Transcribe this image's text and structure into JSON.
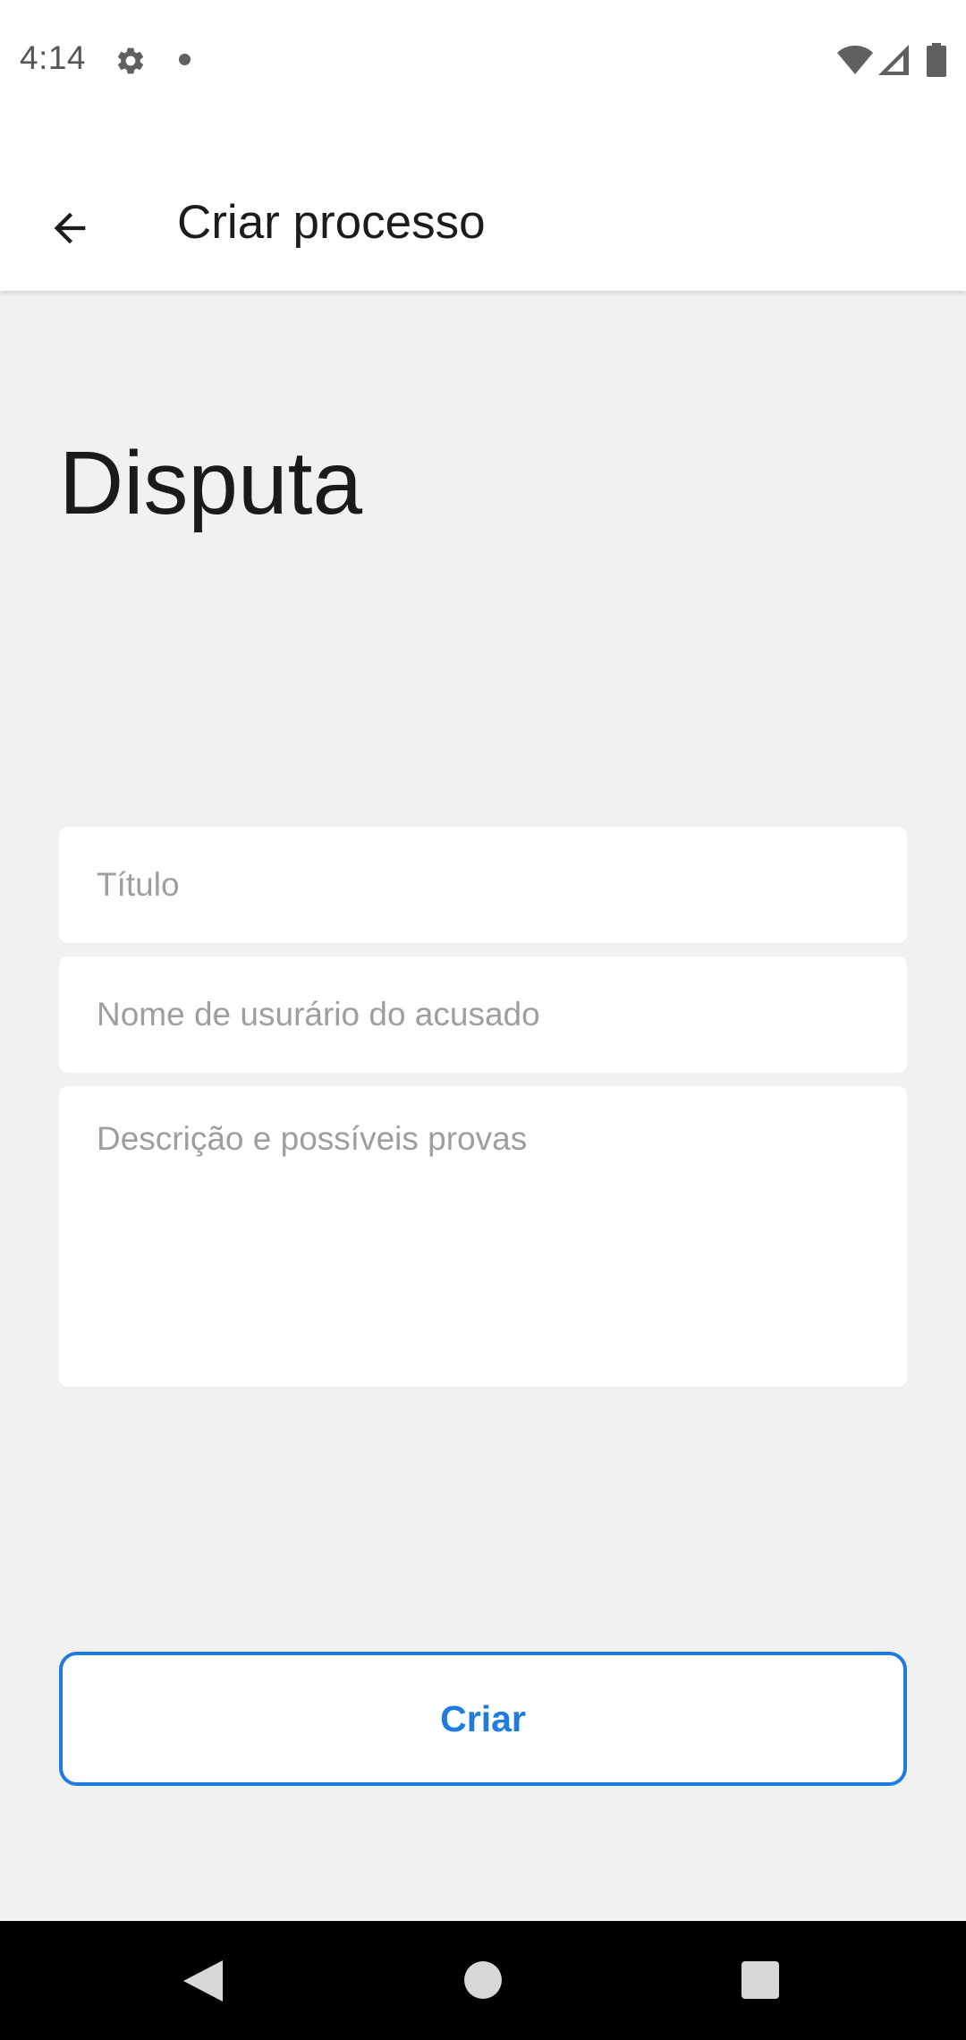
{
  "status_bar": {
    "time": "4:14",
    "icons": [
      "gear-icon",
      "notification-dot-icon",
      "wifi-icon",
      "cell-signal-icon",
      "battery-icon"
    ]
  },
  "app_bar": {
    "back_icon": "arrow-back-icon",
    "title": "Criar processo"
  },
  "form": {
    "heading": "Disputa",
    "title_field": {
      "placeholder": "Título",
      "value": ""
    },
    "accused_field": {
      "placeholder": "Nome de usurário do acusado",
      "value": ""
    },
    "description_field": {
      "placeholder": "Descrição e possíveis provas",
      "value": ""
    },
    "submit_label": "Criar"
  },
  "nav_bar": {
    "icons": [
      "nav-back-icon",
      "nav-home-icon",
      "nav-recents-icon"
    ]
  },
  "colors": {
    "accent": "#1e7be0",
    "background": "#f1f1f1",
    "surface": "#ffffff",
    "nav_bar": "#000000"
  }
}
